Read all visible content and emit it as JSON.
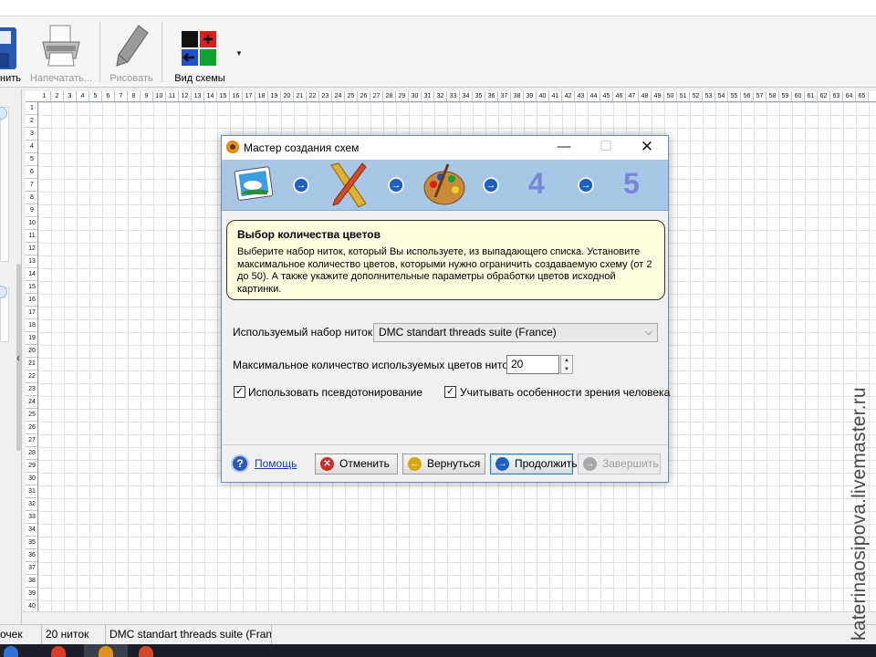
{
  "toolbar": {
    "save_label": "нить",
    "print_label": "Напечатать...",
    "draw_label": "Рисовать",
    "view_label": "Вид схемы"
  },
  "ruler": {
    "columns": [
      "1",
      "2",
      "3",
      "4",
      "5",
      "6",
      "7",
      "8",
      "9",
      "10",
      "11",
      "12",
      "13",
      "14",
      "15",
      "16",
      "17",
      "18",
      "19",
      "20",
      "21",
      "22",
      "23",
      "24",
      "25",
      "26",
      "27",
      "28",
      "29",
      "30",
      "31",
      "32",
      "33",
      "34",
      "35",
      "36",
      "37",
      "38",
      "39",
      "40",
      "41",
      "42",
      "43",
      "44",
      "45",
      "46",
      "47",
      "48",
      "49",
      "50",
      "51",
      "52",
      "53",
      "54",
      "55",
      "56",
      "57",
      "58",
      "59",
      "60",
      "61",
      "62",
      "63",
      "64",
      "65"
    ],
    "rows": [
      "1",
      "2",
      "3",
      "4",
      "5",
      "6",
      "7",
      "8",
      "9",
      "10",
      "11",
      "12",
      "13",
      "14",
      "15",
      "16",
      "17",
      "18",
      "19",
      "20",
      "21",
      "22",
      "23",
      "24",
      "25",
      "26",
      "27",
      "28",
      "29",
      "30",
      "31",
      "32",
      "33",
      "34",
      "35",
      "36",
      "37",
      "38",
      "39",
      "40"
    ]
  },
  "statusbar": {
    "points": "очек",
    "threads": "20 ниток",
    "suite": "DMC standart threads suite (Franc"
  },
  "watermark": "katerinaosipova.livemaster.ru",
  "dialog": {
    "title": "Мастер создания схем",
    "step_four": "4",
    "step_five": "5",
    "info_heading": "Выбор количества цветов",
    "info_text": "Выберите набор ниток, который Вы используете, из выпадающего списка. Установите максимальное количество цветов, которыми нужно ограничить создаваемую схему (от 2 до 50). А также укажите дополнительные параметры обработки цветов исходной картинки.",
    "thread_set_label": "Используемый набор ниток:",
    "thread_set_value": "DMC standart threads suite (France)",
    "max_colors_label": "Максимальное количество используемых цветов ниток:",
    "max_colors_value": "20",
    "pseudotoning_label": "Использовать псевдотонирование",
    "pseudotoning_checked": true,
    "vision_label": "Учитывать особенности зрения человека",
    "vision_checked": true,
    "help_label": "Помощь",
    "cancel_label": "Отменить",
    "back_label": "Вернуться",
    "continue_label": "Продолжить",
    "finish_label": "Завершить"
  },
  "colors": {
    "banner": "#a8c6e6",
    "infobox": "#fffde0",
    "step_number": "#7b86d8",
    "link": "#1a3fb0"
  }
}
